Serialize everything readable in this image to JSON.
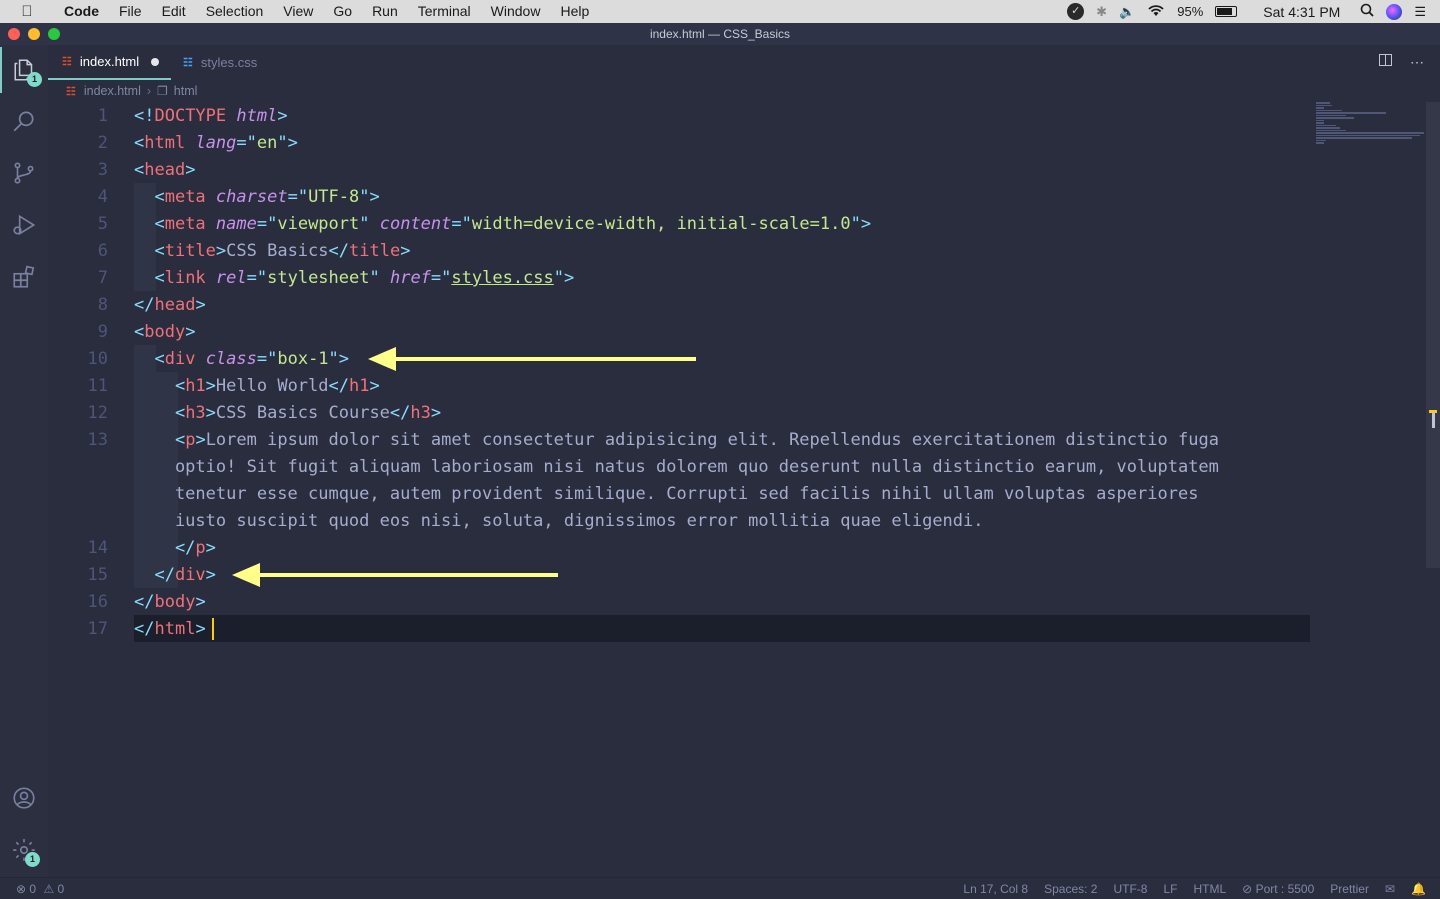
{
  "menubar": {
    "app": "Code",
    "items": [
      "File",
      "Edit",
      "Selection",
      "View",
      "Go",
      "Run",
      "Terminal",
      "Window",
      "Help"
    ],
    "battery": "95%",
    "clock": "Sat 4:31 PM"
  },
  "window": {
    "title": "index.html — CSS_Basics"
  },
  "activity": {
    "explorer_badge": "1",
    "settings_badge": "1"
  },
  "tabs": [
    {
      "label": "index.html",
      "icon": "html5-icon",
      "modified": true
    },
    {
      "label": "styles.css",
      "icon": "css3-icon",
      "modified": false
    }
  ],
  "breadcrumb": {
    "file": "index.html",
    "symbol": "html"
  },
  "editor": {
    "line_numbers": [
      "1",
      "2",
      "3",
      "4",
      "5",
      "6",
      "7",
      "8",
      "9",
      "10",
      "11",
      "12",
      "13",
      "14",
      "15",
      "16",
      "17"
    ],
    "lines": [
      {
        "tokens": [
          [
            "p",
            "<!"
          ],
          [
            "t",
            "DOCTYPE"
          ],
          [
            "p",
            " "
          ],
          [
            "a",
            "html"
          ],
          [
            "p",
            ">"
          ]
        ]
      },
      {
        "tokens": [
          [
            "p",
            "<"
          ],
          [
            "t",
            "html"
          ],
          [
            "p",
            " "
          ],
          [
            "a",
            "lang"
          ],
          [
            "p",
            "=\""
          ],
          [
            "s",
            "en"
          ],
          [
            "p",
            "\">"
          ]
        ]
      },
      {
        "tokens": [
          [
            "p",
            "<"
          ],
          [
            "t",
            "head"
          ],
          [
            "p",
            ">"
          ]
        ]
      },
      {
        "tokens": [
          [
            "p",
            "  <"
          ],
          [
            "t",
            "meta"
          ],
          [
            "p",
            " "
          ],
          [
            "a",
            "charset"
          ],
          [
            "p",
            "=\""
          ],
          [
            "s",
            "UTF-8"
          ],
          [
            "p",
            "\">"
          ]
        ]
      },
      {
        "tokens": [
          [
            "p",
            "  <"
          ],
          [
            "t",
            "meta"
          ],
          [
            "p",
            " "
          ],
          [
            "a",
            "name"
          ],
          [
            "p",
            "=\""
          ],
          [
            "s",
            "viewport"
          ],
          [
            "p",
            "\" "
          ],
          [
            "a",
            "content"
          ],
          [
            "p",
            "=\""
          ],
          [
            "s",
            "width=device-width, initial-scale=1.0"
          ],
          [
            "p",
            "\">"
          ]
        ]
      },
      {
        "tokens": [
          [
            "p",
            "  <"
          ],
          [
            "t",
            "title"
          ],
          [
            "p",
            ">"
          ],
          [
            "x",
            "CSS Basics"
          ],
          [
            "p",
            "</"
          ],
          [
            "t",
            "title"
          ],
          [
            "p",
            ">"
          ]
        ]
      },
      {
        "tokens": [
          [
            "p",
            "  <"
          ],
          [
            "t",
            "link"
          ],
          [
            "p",
            " "
          ],
          [
            "a",
            "rel"
          ],
          [
            "p",
            "=\""
          ],
          [
            "s",
            "stylesheet"
          ],
          [
            "p",
            "\" "
          ],
          [
            "a",
            "href"
          ],
          [
            "p",
            "=\""
          ],
          [
            "su",
            "styles.css"
          ],
          [
            "p",
            "\">"
          ]
        ]
      },
      {
        "tokens": [
          [
            "p",
            "</"
          ],
          [
            "t",
            "head"
          ],
          [
            "p",
            ">"
          ]
        ]
      },
      {
        "tokens": [
          [
            "p",
            "<"
          ],
          [
            "t",
            "body"
          ],
          [
            "p",
            ">"
          ]
        ]
      },
      {
        "tokens": [
          [
            "p",
            "  <"
          ],
          [
            "t",
            "div"
          ],
          [
            "p",
            " "
          ],
          [
            "a",
            "class"
          ],
          [
            "p",
            "=\""
          ],
          [
            "s",
            "box-1"
          ],
          [
            "p",
            "\">"
          ]
        ]
      },
      {
        "tokens": [
          [
            "p",
            "    <"
          ],
          [
            "t",
            "h1"
          ],
          [
            "p",
            ">"
          ],
          [
            "x",
            "Hello World"
          ],
          [
            "p",
            "</"
          ],
          [
            "t",
            "h1"
          ],
          [
            "p",
            ">"
          ]
        ]
      },
      {
        "tokens": [
          [
            "p",
            "    <"
          ],
          [
            "t",
            "h3"
          ],
          [
            "p",
            ">"
          ],
          [
            "x",
            "CSS Basics Course"
          ],
          [
            "p",
            "</"
          ],
          [
            "t",
            "h3"
          ],
          [
            "p",
            ">"
          ]
        ]
      },
      {
        "tokens": [
          [
            "p",
            "    <"
          ],
          [
            "t",
            "p"
          ],
          [
            "p",
            ">"
          ],
          [
            "x",
            "Lorem ipsum dolor sit amet consectetur adipisicing elit. Repellendus exercitationem distinctio fuga"
          ]
        ]
      },
      {
        "tokens": [
          [
            "x",
            "    optio! Sit fugit aliquam laboriosam nisi natus dolorem quo deserunt nulla distinctio earum, voluptatem"
          ]
        ]
      },
      {
        "tokens": [
          [
            "x",
            "    tenetur esse cumque, autem provident similique. Corrupti sed facilis nihil ullam voluptas asperiores"
          ]
        ]
      },
      {
        "tokens": [
          [
            "x",
            "    iusto suscipit quod eos nisi, soluta, dignissimos error mollitia quae eligendi."
          ]
        ]
      },
      {
        "tokens": [
          [
            "p",
            "    </"
          ],
          [
            "t",
            "p"
          ],
          [
            "p",
            ">"
          ]
        ]
      },
      {
        "tokens": [
          [
            "p",
            "  </"
          ],
          [
            "t",
            "div"
          ],
          [
            "p",
            ">"
          ]
        ]
      },
      {
        "tokens": [
          [
            "p",
            "</"
          ],
          [
            "t",
            "body"
          ],
          [
            "p",
            ">"
          ]
        ]
      },
      {
        "tokens": [
          [
            "p",
            "</"
          ],
          [
            "t",
            "html"
          ],
          [
            "p",
            ">"
          ]
        ]
      }
    ]
  },
  "statusbar": {
    "errors": "0",
    "warnings": "0",
    "position": "Ln 17, Col 8",
    "spaces": "Spaces: 2",
    "encoding": "UTF-8",
    "eol": "LF",
    "language": "HTML",
    "port": "Port : 5500",
    "formatter": "Prettier"
  },
  "colors": {
    "background": "#292d3e",
    "tag": "#f07178",
    "attribute": "#c792ea",
    "string": "#c3e88d",
    "punctuation": "#89ddff",
    "annotation_arrow": "#ffff8a",
    "accent": "#80cbc4"
  }
}
